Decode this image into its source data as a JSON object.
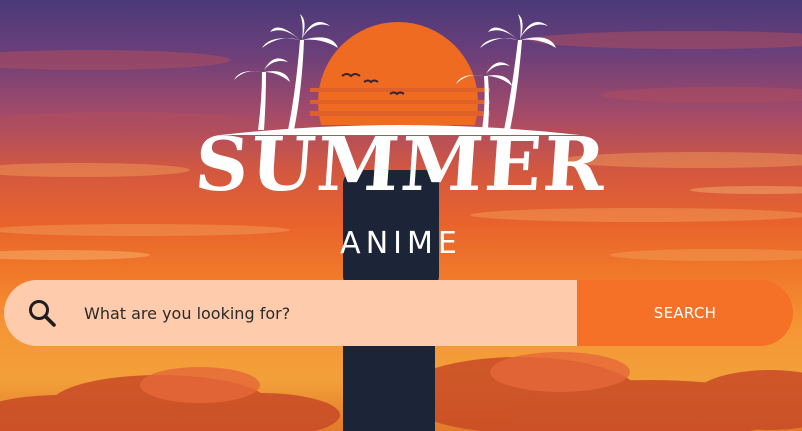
{
  "hero": {
    "logo": {
      "title": "SUMMER",
      "subtitle": "ANIME"
    }
  },
  "search": {
    "placeholder": "What are you looking for?",
    "value": "",
    "button_label": "SEARCH",
    "icon": "search-icon"
  },
  "colors": {
    "search_field_bg": "#fecbad",
    "search_button_bg": "#f47127",
    "logo_sun": "#f06b22"
  }
}
